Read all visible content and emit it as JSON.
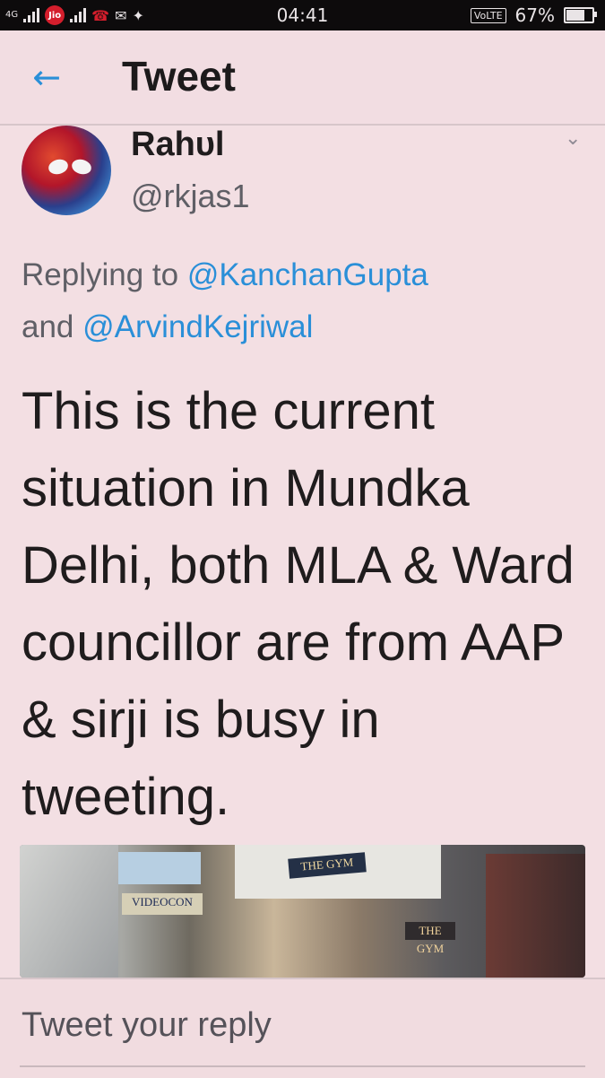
{
  "status_bar": {
    "network_label": "4G",
    "carrier": "Jio",
    "time": "04:41",
    "volte": "VoLTE",
    "battery_percent": "67%",
    "battery_level": 0.67
  },
  "header": {
    "back_icon": "arrow-left-icon",
    "title": "Tweet"
  },
  "tweet": {
    "author_name": "Rahυl",
    "author_handle": "@rkjas1",
    "replying_prefix": "Replying to ",
    "mention_1": "@KanchanGupta",
    "replying_and": "and ",
    "mention_2": "@ArvindKejriwal",
    "text": "This is the current situation in Mundka Delhi, both MLA & Ward councillor are from AAP & sirji is busy in tweeting.",
    "photo_signs": {
      "gym_top": "THE GYM",
      "videocon": "VIDEOCON",
      "gym_lower": "THE GYM"
    }
  },
  "reply_bar": {
    "placeholder": "Tweet your reply"
  },
  "colors": {
    "accent": "#2a8fd8",
    "background": "#f3dfe3",
    "status_bar": "#0d0b0c"
  }
}
